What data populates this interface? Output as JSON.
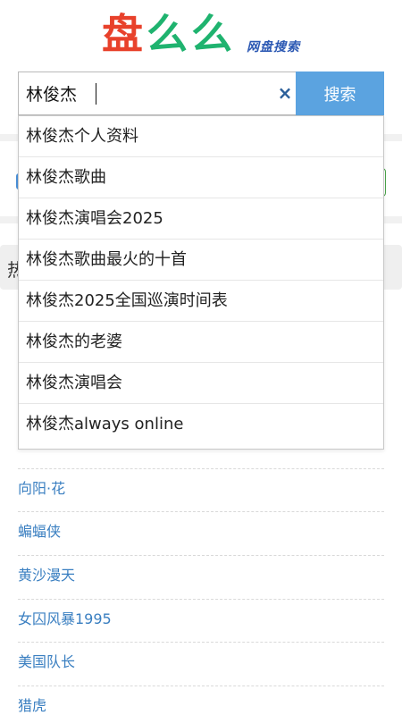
{
  "logo": {
    "chars": [
      "盘",
      "么",
      "么"
    ],
    "subtitle": "网盘搜索",
    "colors": {
      "first": "#e8412b",
      "rest": "#1fb36f",
      "subtitle": "#2b58b3"
    }
  },
  "search": {
    "value": "林俊杰",
    "button_label": "搜索",
    "clear_icon": "×"
  },
  "suggestions": [
    "林俊杰个人资料",
    "林俊杰歌曲",
    "林俊杰演唱会2025",
    "林俊杰歌曲最火的十首",
    "林俊杰2025全国巡演时间表",
    "林俊杰的老婆",
    "林俊杰演唱会",
    "林俊杰always online"
  ],
  "hot": {
    "title_partial": "热",
    "items": [
      "向阳·花",
      "蝙蝠侠",
      "黄沙漫天",
      "女囚风暴1995",
      "美国队长",
      "猎虎"
    ]
  },
  "colors": {
    "accent": "#5ba3e0",
    "link": "#3a7fc1"
  }
}
